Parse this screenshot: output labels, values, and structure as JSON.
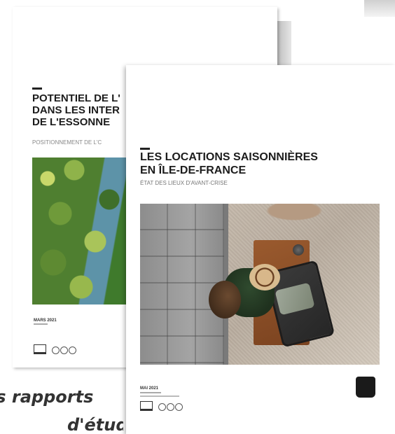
{
  "back_report": {
    "title_lines": [
      "POTENTIEL DE L'",
      "DANS LES INTER",
      "DE L'ESSONNE"
    ],
    "subtitle": "POSITIONNEMENT DE L'C",
    "date": "MARS 2021"
  },
  "front_report": {
    "title_lines": [
      "LES LOCATIONS SAISONNIÈRES",
      "EN ÎLE-DE-FRANCE"
    ],
    "subtitle": "ÉTAT DES LIEUX D'AVANT-CRISE",
    "date": "MAI 2021"
  },
  "caption": {
    "line1": "es rapports",
    "line2": "d'étude"
  },
  "colors": {
    "title_text": "#1c1c1c",
    "caption_text": "#333333",
    "logo_bg": "#1a1a1a"
  },
  "icons": [
    "laptop-icon",
    "social-icon-twitter",
    "social-icon-linkedin",
    "social-icon-facebook",
    "institute-logo"
  ]
}
